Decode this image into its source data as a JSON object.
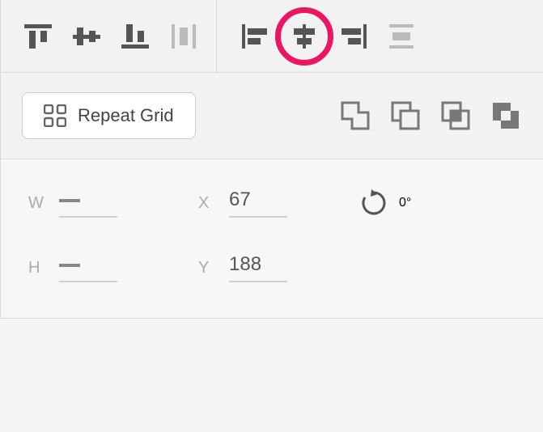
{
  "align": {
    "top": "align-top",
    "middle": "align-middle",
    "bottom": "align-bottom",
    "stretch_v": "stretch-vertical",
    "left": "align-left",
    "center": "align-center",
    "right": "align-right",
    "stretch_h": "stretch-horizontal",
    "highlighted": "align-center"
  },
  "repeat": {
    "label": "Repeat Grid"
  },
  "booleans": {
    "add": "boolean-add",
    "subtract": "boolean-subtract",
    "intersect": "boolean-intersect",
    "exclude": "boolean-exclude"
  },
  "transform": {
    "w_label": "W",
    "w_value": "",
    "h_label": "H",
    "h_value": "",
    "x_label": "X",
    "x_value": "67",
    "y_label": "Y",
    "y_value": "188",
    "rotation_label": "0°"
  }
}
